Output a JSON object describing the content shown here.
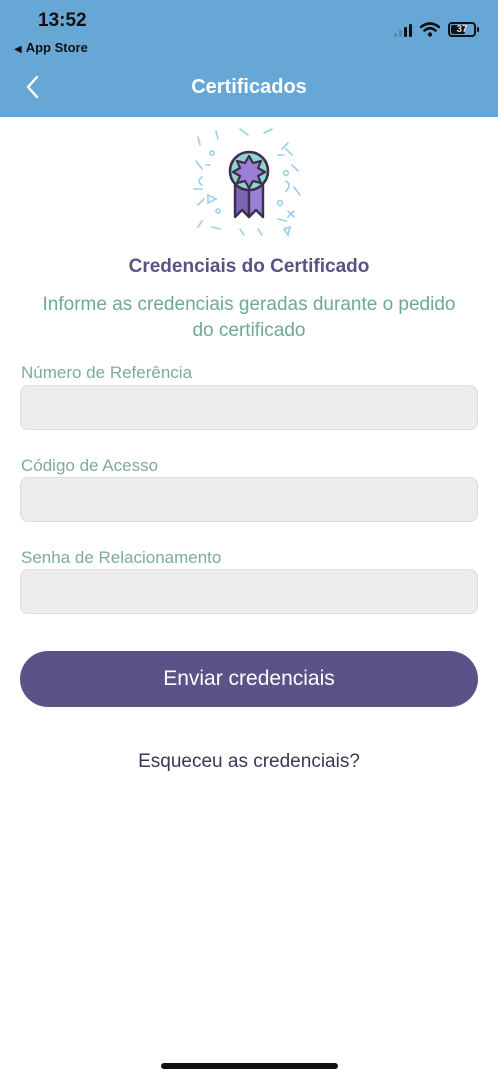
{
  "status_bar": {
    "time": "13:52",
    "back_app": "App Store",
    "battery": "37"
  },
  "nav": {
    "title": "Certificados",
    "back_icon": "chevron-left-icon"
  },
  "illustration": {
    "icon": "award-ribbon-icon",
    "colors": {
      "medal": "#8fd6c8",
      "star": "#9b7fd4",
      "ribbon": "#7b65b8",
      "outline": "#3a2f4f",
      "confetti": "#9ccfe8"
    }
  },
  "content": {
    "heading": "Credenciais do Certificado",
    "subtitle": "Informe as credenciais geradas durante o pedido do certificado"
  },
  "form": {
    "fields": [
      {
        "label": "Número de Referência",
        "value": "",
        "placeholder": ""
      },
      {
        "label": "Código de Acesso",
        "value": "",
        "placeholder": ""
      },
      {
        "label": "Senha de Relacionamento",
        "value": "",
        "placeholder": ""
      }
    ],
    "submit_label": "Enviar credenciais",
    "forgot_label": "Esqueceu as credenciais?"
  },
  "colors": {
    "header": "#66a7d6",
    "primary": "#5d5287",
    "label": "#7dab9e",
    "heading": "#5b5185"
  }
}
